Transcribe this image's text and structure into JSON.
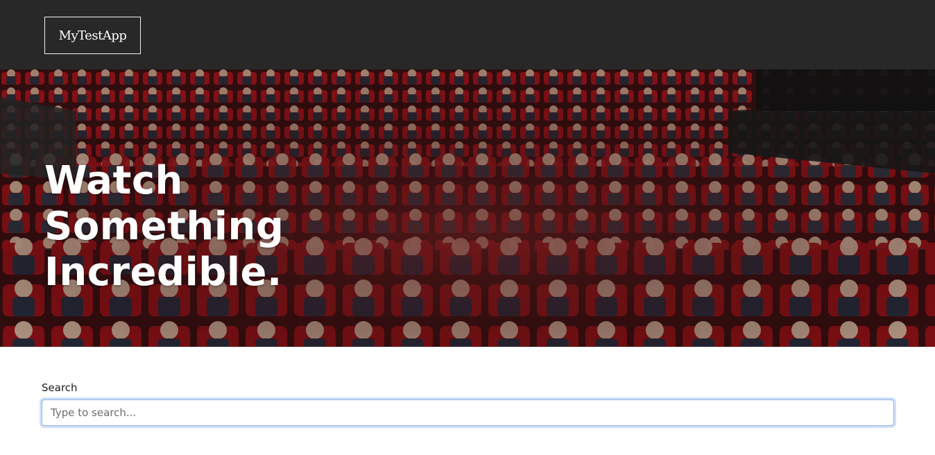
{
  "header": {
    "logo_label": "MyTestApp"
  },
  "hero": {
    "title_lines": [
      "Watch",
      "Something",
      "Incredible."
    ]
  },
  "search": {
    "label": "Search",
    "placeholder": "Type to search...",
    "value": ""
  },
  "colors": {
    "header_bg": "#282828",
    "seat_red": "#b3161c",
    "focus_ring": "#8fb4e8"
  }
}
